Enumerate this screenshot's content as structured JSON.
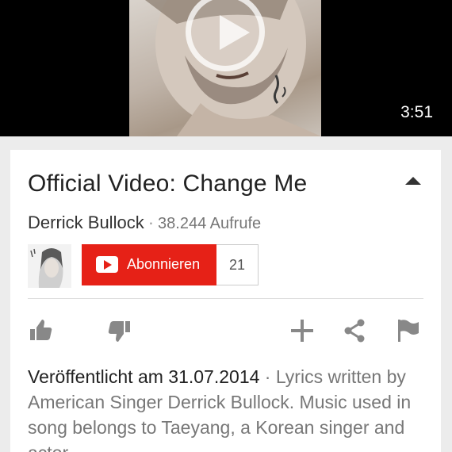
{
  "video": {
    "duration": "3:51"
  },
  "info": {
    "title": "Official Video: Change Me",
    "channel": "Derrick Bullock",
    "separator": "·",
    "views": "38.244 Aufrufe"
  },
  "subscribe": {
    "label": "Abonnieren",
    "count": "21"
  },
  "actions": [
    "like-icon",
    "dislike-icon",
    "add-icon",
    "share-icon",
    "flag-icon"
  ],
  "description": {
    "published": "Veröffentlicht am 31.07.2014",
    "separator": " · ",
    "text": "Lyrics written by American Singer Derrick Bullock. Music used in song belongs to Taeyang, a Korean singer and actor."
  },
  "colors": {
    "subscribe_red": "#e62117",
    "player_bg": "#000000",
    "page_bg": "#ececec"
  }
}
